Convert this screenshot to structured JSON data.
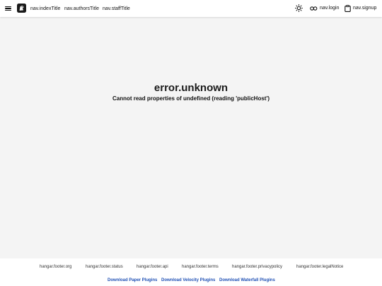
{
  "nav": {
    "index_title": "nav.indexTitle",
    "authors_title": "nav.authorsTitle",
    "staff_title": "nav.staffTitle",
    "login": "nav.login",
    "signup": "nav.signup"
  },
  "error": {
    "title": "error.unknown",
    "message": "Cannot read properties of undefined (reading 'publicHost')"
  },
  "footer": {
    "links": [
      "hangar.footer.org",
      "hangar.footer.status",
      "hangar.footer.api",
      "hangar.footer.terms",
      "hangar.footer.privacypolicy",
      "hangar.footer.legalNotice"
    ],
    "downloads": [
      "Download Paper Plugins",
      "Download Velocity Plugins",
      "Download Waterfall Plugins"
    ]
  },
  "colors": {
    "background": "#f4f4f4",
    "header_bg": "#ffffff",
    "link_blue": "#1e4fb4"
  }
}
